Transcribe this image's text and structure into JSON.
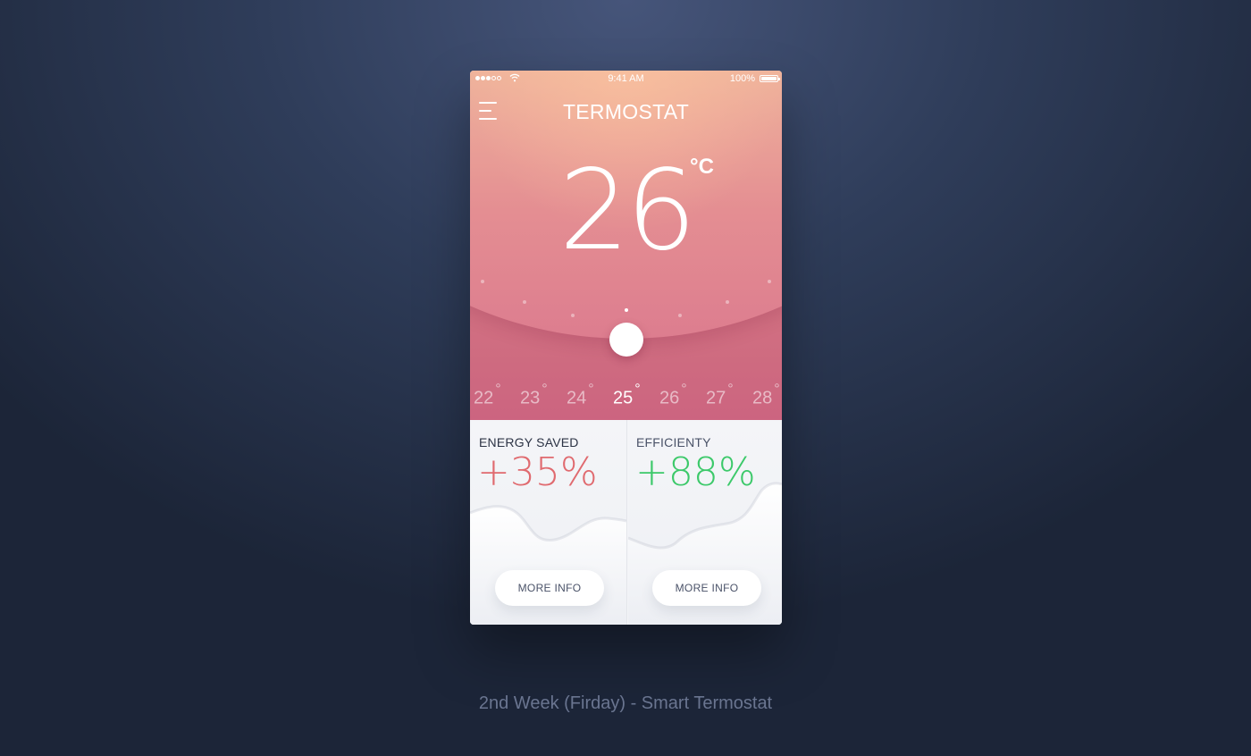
{
  "status_bar": {
    "time": "9:41 AM",
    "battery": "100%",
    "signal_bars": 3,
    "signal_total": 5
  },
  "header": {
    "title": "TERMOSTAT",
    "menu_icon": "hamburger-menu-icon"
  },
  "thermostat": {
    "current_temp": "26",
    "unit": "°C",
    "scale": [
      "22",
      "23",
      "24",
      "25",
      "26",
      "27",
      "28"
    ],
    "selected_index": 3,
    "degree_symbol": "°"
  },
  "cards": {
    "energy": {
      "label": "ENERGY SAVED",
      "value": "+35%",
      "color": "#e06a6f",
      "button": "MORE INFO"
    },
    "efficiency": {
      "label": "EFFICIENTY",
      "value": "+88%",
      "color": "#3cc96a",
      "button": "MORE INFO"
    }
  },
  "caption": "2nd Week (Firday) - Smart Termostat"
}
